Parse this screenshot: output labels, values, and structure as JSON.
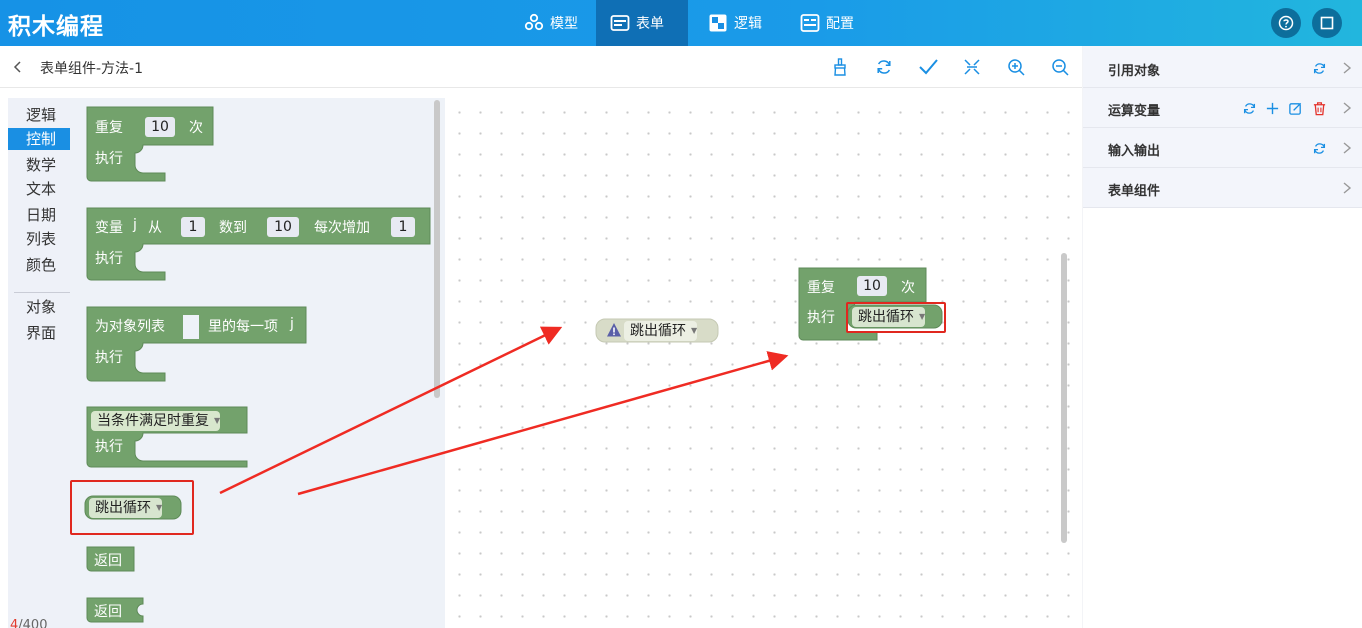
{
  "app": {
    "title": "积木编程"
  },
  "nav": {
    "tabs": [
      {
        "label": "模型",
        "icon": "model-icon",
        "active": false
      },
      {
        "label": "表单",
        "icon": "form-icon",
        "active": true
      },
      {
        "label": "逻辑",
        "icon": "logic-icon",
        "active": false
      },
      {
        "label": "配置",
        "icon": "config-icon",
        "active": false
      }
    ],
    "right_icons": [
      "help-icon",
      "fullscreen-icon"
    ]
  },
  "subheader": {
    "title": "表单组件-方法-1",
    "tools": [
      "clean-icon",
      "refresh-icon",
      "check-icon",
      "collapse-icon",
      "zoom-in-icon",
      "zoom-out-icon"
    ]
  },
  "categories": {
    "items": [
      "逻辑",
      "控制",
      "数学",
      "文本",
      "日期",
      "列表",
      "颜色",
      "对象",
      "界面"
    ],
    "active": "控制"
  },
  "flyout_blocks": {
    "repeat": {
      "label": "重复",
      "count": "10",
      "suffix": "次",
      "do": "执行"
    },
    "for_range": {
      "label": "变量",
      "var": "j",
      "from": "从",
      "from_val": "1",
      "to": "数到",
      "to_val": "10",
      "step": "每次增加",
      "step_val": "1",
      "do": "执行"
    },
    "for_each": {
      "label": "为对象列表",
      "item": "里的每一项",
      "var": "j",
      "do": "执行"
    },
    "while": {
      "label": "当条件满足时重复",
      "do": "执行"
    },
    "break": {
      "label": "跳出循环"
    },
    "return1": {
      "label": "返回"
    },
    "return2": {
      "label": "返回"
    }
  },
  "canvas_blocks": {
    "warning_block": {
      "label": "跳出循环",
      "icon": "warning-icon"
    },
    "repeat": {
      "label": "重复",
      "count": "10",
      "suffix": "次",
      "do": "执行",
      "inner": "跳出循环"
    }
  },
  "counter": {
    "current": "4",
    "total": "/400"
  },
  "right_panel": {
    "sections": [
      {
        "label": "引用对象",
        "icons": [
          "refresh-icon"
        ]
      },
      {
        "label": "运算变量",
        "icons": [
          "refresh-icon",
          "add-icon",
          "edit-icon",
          "delete-icon"
        ]
      },
      {
        "label": "输入输出",
        "icons": [
          "refresh-icon"
        ]
      },
      {
        "label": "表单组件",
        "icons": []
      }
    ]
  },
  "colors": {
    "accent": "#1a8fe3",
    "block": "#73a26c",
    "highlight": "#e0281f",
    "arrow": "#ef2b23"
  }
}
